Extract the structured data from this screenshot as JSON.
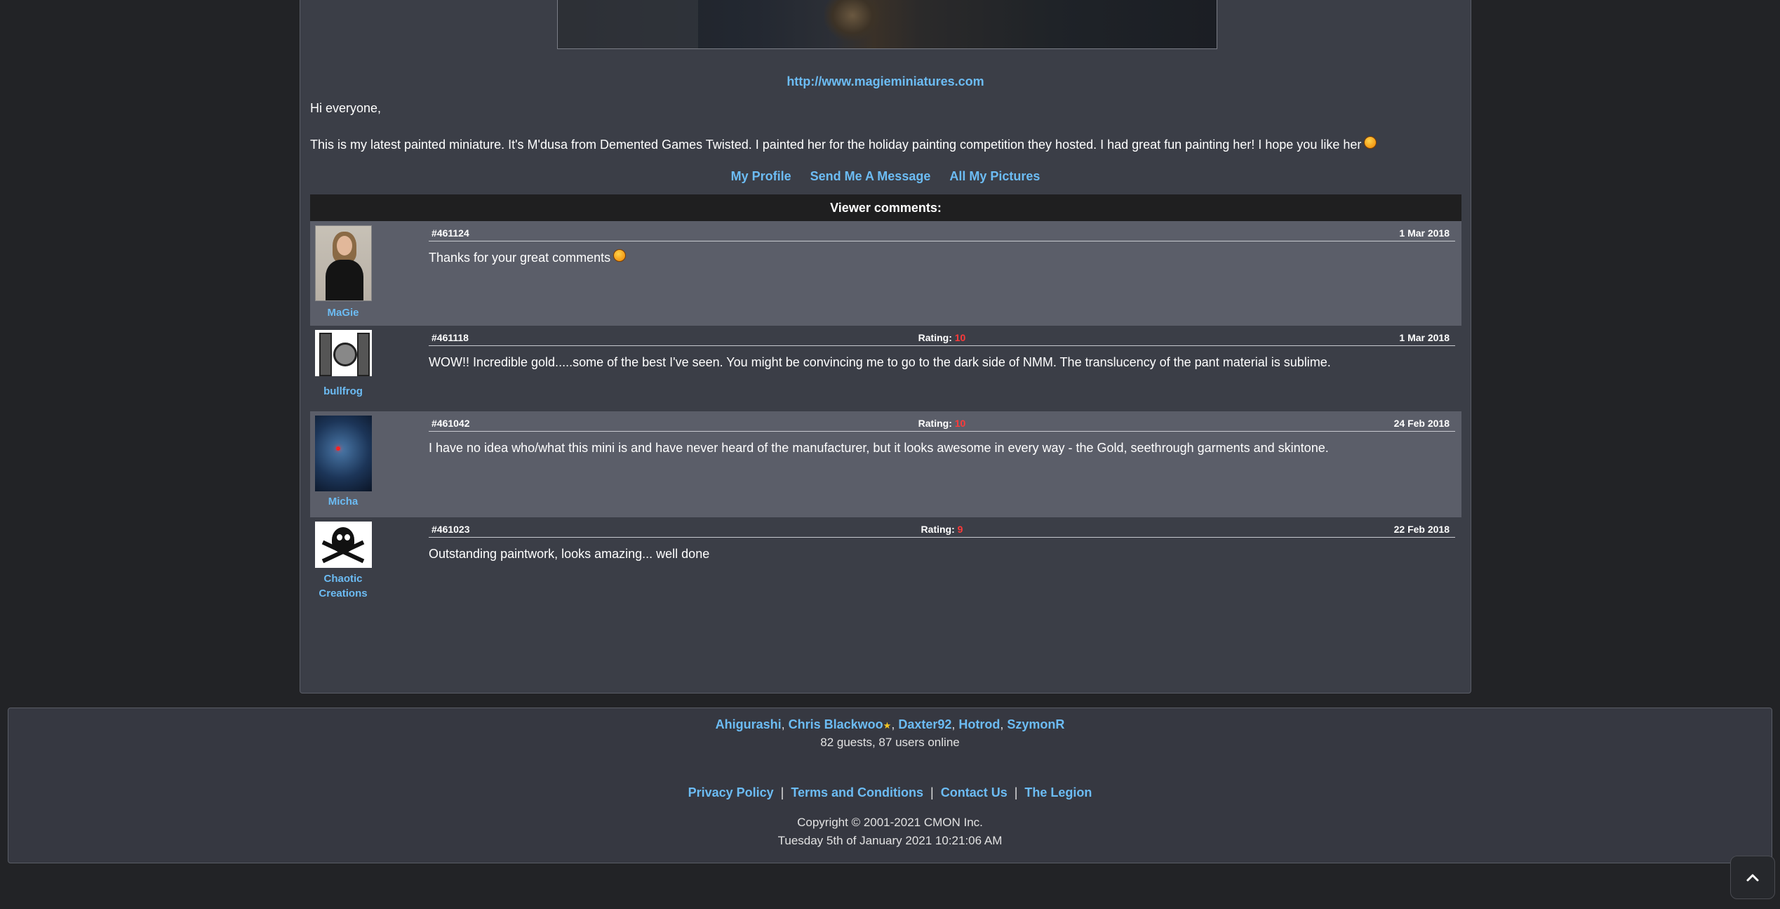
{
  "post": {
    "website_link": "http://www.magieminiatures.com",
    "greeting": "Hi everyone,",
    "description": "This is my latest painted miniature. It's M'dusa from Demented Games Twisted. I painted her for the holiday painting competition they hosted. I had great fun painting her! I hope you like her",
    "profile_links": [
      "My Profile",
      "Send Me A Message",
      "All My Pictures"
    ]
  },
  "comments": {
    "header": "Viewer comments:",
    "items": [
      {
        "user": "MaGie",
        "id": "#461124",
        "rating_label": "",
        "rating": "",
        "date": "1 Mar 2018",
        "text": "Thanks for your great comments"
      },
      {
        "user": "bullfrog",
        "id": "#461118",
        "rating_label": "Rating:",
        "rating": "10",
        "date": "1 Mar 2018",
        "text": "WOW!! Incredible gold.....some of the best I've seen. You might be convincing me to go to the dark side of NMM. The translucency of the pant material is sublime."
      },
      {
        "user": "Micha",
        "id": "#461042",
        "rating_label": "Rating:",
        "rating": "10",
        "date": "24 Feb 2018",
        "text": "I have no idea who/what this mini is and have never heard of the manufacturer, but it looks awesome in every way - the Gold, seethrough garments and skintone."
      },
      {
        "user": "Chaotic Creations",
        "id": "#461023",
        "rating_label": "Rating:",
        "rating": "9",
        "date": "22 Feb 2018",
        "text": "Outstanding paintwork, looks amazing... well done"
      }
    ]
  },
  "footer": {
    "online_users": [
      "Ahigurashi",
      "Chris Blackwoo",
      "Daxter92",
      "Hotrod",
      "SzymonR"
    ],
    "online_count": "82 guests, 87 users online",
    "links": [
      "Privacy Policy",
      "Terms and Conditions",
      "Contact Us",
      "The Legion"
    ],
    "copyright": "Copyright © 2001-2021 CMON Inc.",
    "timestamp": "Tuesday 5th of January 2021 10:21:06 AM"
  },
  "colors": {
    "background": "#222326",
    "panel": "#3b3e47",
    "row_light": "#5b5e69",
    "link": "#6cbcf4",
    "rating": "#ff3a3a"
  },
  "icons": {
    "smiley": "smiley-icon",
    "star": "star-icon",
    "scroll_top": "chevron-up-icon"
  }
}
